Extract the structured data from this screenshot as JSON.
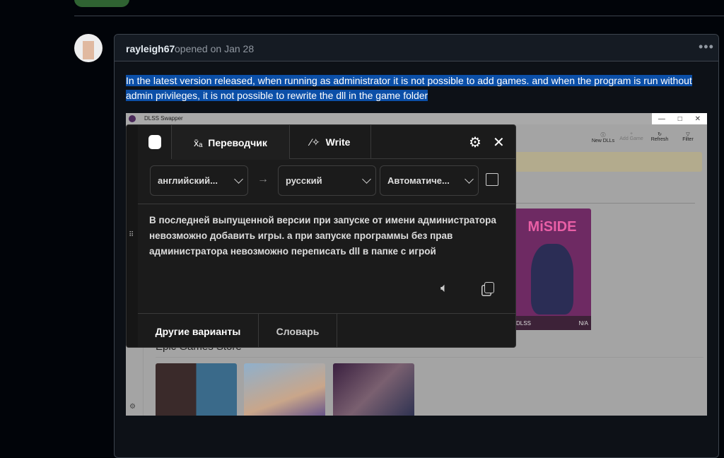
{
  "comment": {
    "author": "rayleigh67",
    "meta": "opened on Jan 28",
    "menu": "•••",
    "body": "In the latest version released, when running as administrator it is not possible to add games. and when the program is run without admin privileges, it is not possible to rewrite the dll in the game folder"
  },
  "screenshot": {
    "app_title": "DLSS Swapper",
    "toolbar": [
      {
        "label": "New DLLs",
        "icon": "info-icon"
      },
      {
        "label": "Add Game",
        "icon": "plus-icon"
      },
      {
        "label": "Refresh",
        "icon": "refresh-icon"
      },
      {
        "label": "Filter",
        "icon": "filter-icon"
      }
    ],
    "section": "Epic Games Store",
    "game_card": {
      "title": "MiSIDE",
      "dll": "DLSS",
      "version": "N/A"
    }
  },
  "translator": {
    "tab_translate": "Переводчик",
    "tab_write": "Write",
    "source_lang": "английский...",
    "target_lang": "русский",
    "formality": "Автоматиче...",
    "arrow": "→",
    "translation": "В последней выпущенной версии при запуске от имени администратора невозможно добавить игры. а при запуске программы без прав администратора невозможно переписать dll в папке с игрой",
    "alternatives": "Другие варианты",
    "dictionary": "Словарь"
  }
}
